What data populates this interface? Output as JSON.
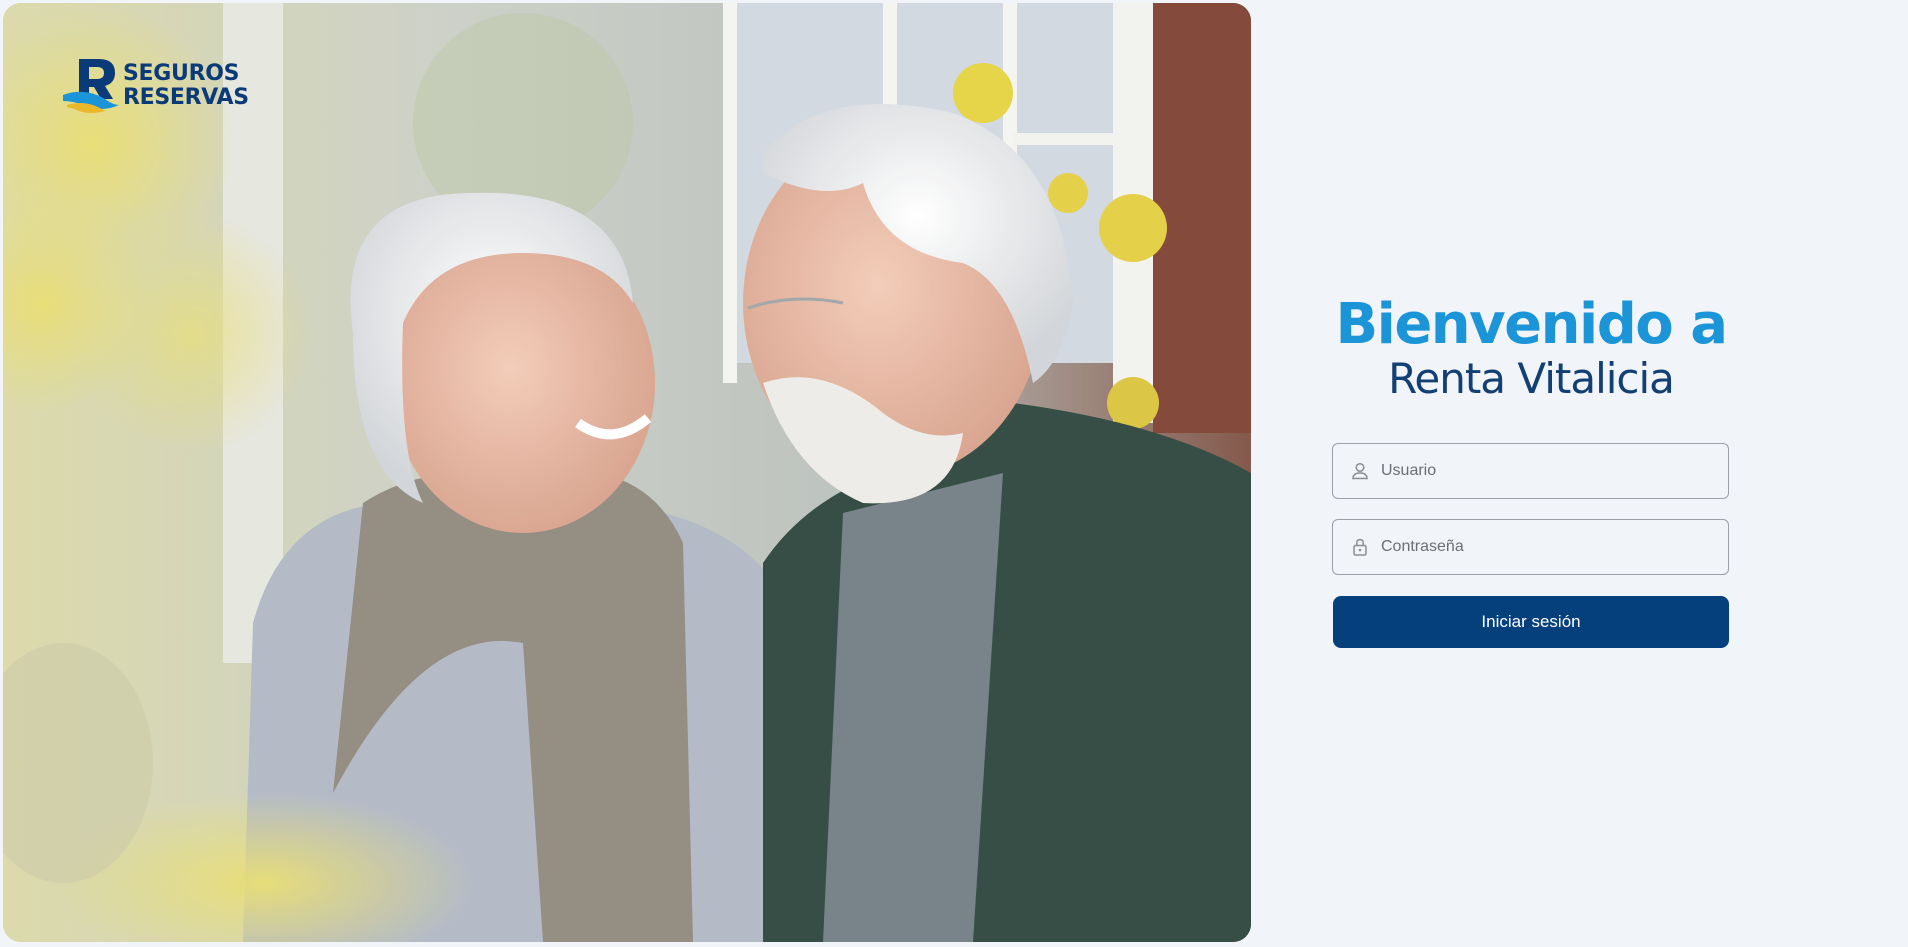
{
  "brand": {
    "line1": "SEGUROS",
    "line2": "RESERVAS",
    "logo_icon": "seguros-reservas-logo",
    "primary_color": "#053f7c",
    "accent_color": "#1b94d8"
  },
  "hero": {
    "image_alt": "",
    "icon": "hero-photo"
  },
  "login": {
    "welcome": "Bienvenido a",
    "product": "Renta Vitalicia",
    "username": {
      "placeholder": "Usuario",
      "value": "",
      "icon": "user-icon"
    },
    "password": {
      "placeholder": "Contraseña",
      "value": "",
      "icon": "lock-icon"
    },
    "submit_label": "Iniciar sesión"
  }
}
